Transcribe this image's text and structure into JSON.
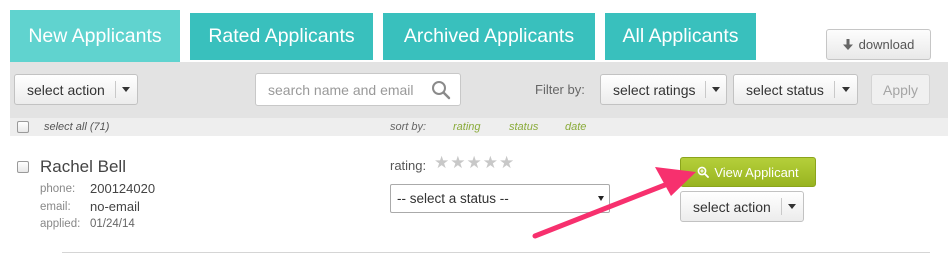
{
  "tabs": [
    "New Applicants",
    "Rated Applicants",
    "Archived Applicants",
    "All Applicants"
  ],
  "download_label": "download",
  "toolbar": {
    "select_action": "select action",
    "search_placeholder": "search name and email",
    "filter_label": "Filter by:",
    "select_ratings": "select ratings",
    "select_status": "select status",
    "apply": "Apply"
  },
  "subbar": {
    "select_all": "select all (71)",
    "sort_by": "sort by:",
    "sort_options": [
      "rating",
      "status",
      "date"
    ]
  },
  "applicant": {
    "name": "Rachel Bell",
    "phone_label": "phone:",
    "phone": "200124020",
    "email_label": "email:",
    "email": "no-email",
    "applied_label": "applied:",
    "applied": "01/24/14",
    "rating_label": "rating:",
    "rating_value": 0,
    "rating_max": 5,
    "status_placeholder": "-- select a status --",
    "view_button": "View Applicant",
    "select_action": "select action"
  },
  "colors": {
    "tab": "#39c0bd",
    "tab_active": "#60d3cf",
    "view_button": "#a8c32c",
    "annotation_arrow": "#f7306e",
    "sort_link": "#8aab3a"
  },
  "icons": {
    "download": "download-arrow-icon",
    "search": "magnifier-icon",
    "view": "zoom-icon"
  }
}
